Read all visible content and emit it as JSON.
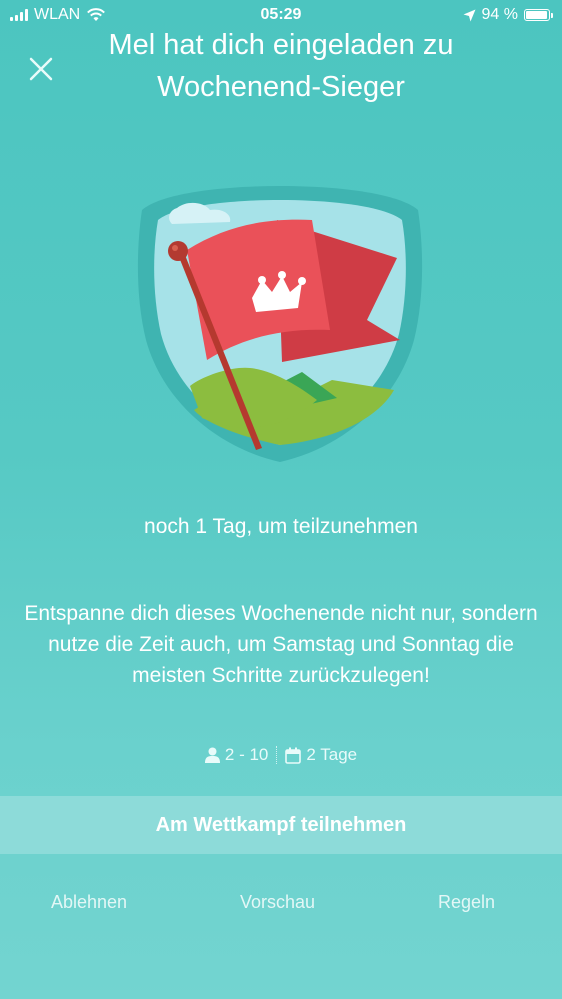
{
  "status_bar": {
    "carrier": "WLAN",
    "time": "05:29",
    "battery": "94 %",
    "battery_level": 0.94
  },
  "header": {
    "title": "Mel hat dich eingeladen zu Wochenend-Sieger",
    "close_icon": "close-icon"
  },
  "challenge": {
    "deadline": "noch 1 Tag, um teilzunehmen",
    "description": "Entspanne dich dieses Wochenende nicht nur, sondern nutze die Zeit auch, um Samstag und Sonntag die meisten Schritte zurückzulegen!",
    "participants": "2 - 10",
    "duration": "2 Tage",
    "participants_icon": "person-icon",
    "duration_icon": "calendar-icon"
  },
  "actions": {
    "join": "Am Wettkampf teilnehmen",
    "decline": "Ablehnen",
    "preview": "Vorschau",
    "rules": "Regeln"
  },
  "colors": {
    "background": "#55c8c3",
    "button": "#8ddbd9",
    "flag": "#e8474f"
  }
}
